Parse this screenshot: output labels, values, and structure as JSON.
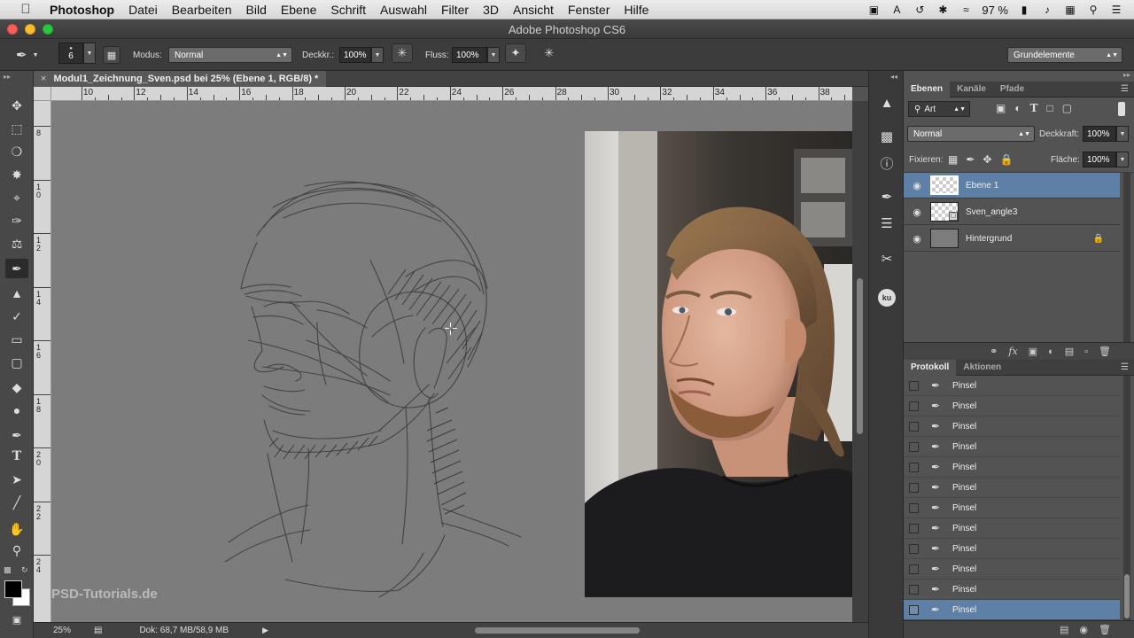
{
  "menubar": {
    "app": "Photoshop",
    "items": [
      "Datei",
      "Bearbeiten",
      "Bild",
      "Ebene",
      "Schrift",
      "Auswahl",
      "Filter",
      "3D",
      "Ansicht",
      "Fenster",
      "Hilfe"
    ],
    "battery": "97 %"
  },
  "window": {
    "title": "Adobe Photoshop CS6"
  },
  "options": {
    "brush_size": "6",
    "mode_label": "Modus:",
    "mode_value": "Normal",
    "opacity_label": "Deckkr.:",
    "opacity_value": "100%",
    "flow_label": "Fluss:",
    "flow_value": "100%",
    "workspace": "Grundelemente"
  },
  "document": {
    "tab_title": "Modul1_Zeichnung_Sven.psd bei 25% (Ebene 1, RGB/8) *",
    "zoom": "25%",
    "doc_size": "Dok: 68,7 MB/58,9 MB",
    "watermark": "PSD-Tutorials.de"
  },
  "rulers": {
    "h_labels": [
      "10",
      "12",
      "14",
      "16",
      "18",
      "20",
      "22",
      "24",
      "26",
      "28",
      "30",
      "32",
      "34",
      "36",
      "38"
    ],
    "v_labels": [
      "8",
      "10",
      "12",
      "14",
      "16",
      "18",
      "20",
      "22",
      "24"
    ]
  },
  "layers_panel": {
    "tabs": [
      "Ebenen",
      "Kanäle",
      "Pfade"
    ],
    "filter_kind": "Art",
    "blend_mode": "Normal",
    "opacity_label": "Deckkraft:",
    "opacity_value": "100%",
    "lock_label": "Fixieren:",
    "fill_label": "Fläche:",
    "fill_value": "100%",
    "layers": [
      {
        "name": "Ebene 1",
        "selected": true
      },
      {
        "name": "Sven_angle3",
        "selected": false
      },
      {
        "name": "Hintergrund",
        "selected": false
      }
    ]
  },
  "history_panel": {
    "tabs": [
      "Protokoll",
      "Aktionen"
    ],
    "items": [
      "Pinsel",
      "Pinsel",
      "Pinsel",
      "Pinsel",
      "Pinsel",
      "Pinsel",
      "Pinsel",
      "Pinsel",
      "Pinsel",
      "Pinsel",
      "Pinsel",
      "Pinsel"
    ]
  },
  "colors": {
    "selection": "#5e7fa6",
    "canvas": "#7c7c7c",
    "panel": "#535353"
  }
}
